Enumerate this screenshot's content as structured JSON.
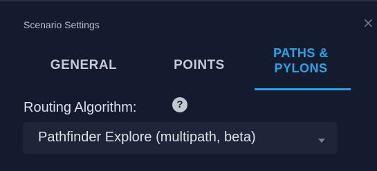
{
  "window": {
    "title": "Scenario Settings",
    "close_symbol": "×"
  },
  "tabs": [
    {
      "label": "GENERAL",
      "active": false
    },
    {
      "label": "POINTS",
      "active": false
    },
    {
      "label": "PATHS & PYLONS",
      "active": true
    }
  ],
  "routing": {
    "label": "Routing Algorithm:",
    "help_symbol": "?",
    "selected_value": "Pathfinder Explore (multipath, beta)"
  },
  "colors": {
    "background": "#151b2e",
    "accent": "#2aa4e8",
    "text": "#dde0e6"
  }
}
